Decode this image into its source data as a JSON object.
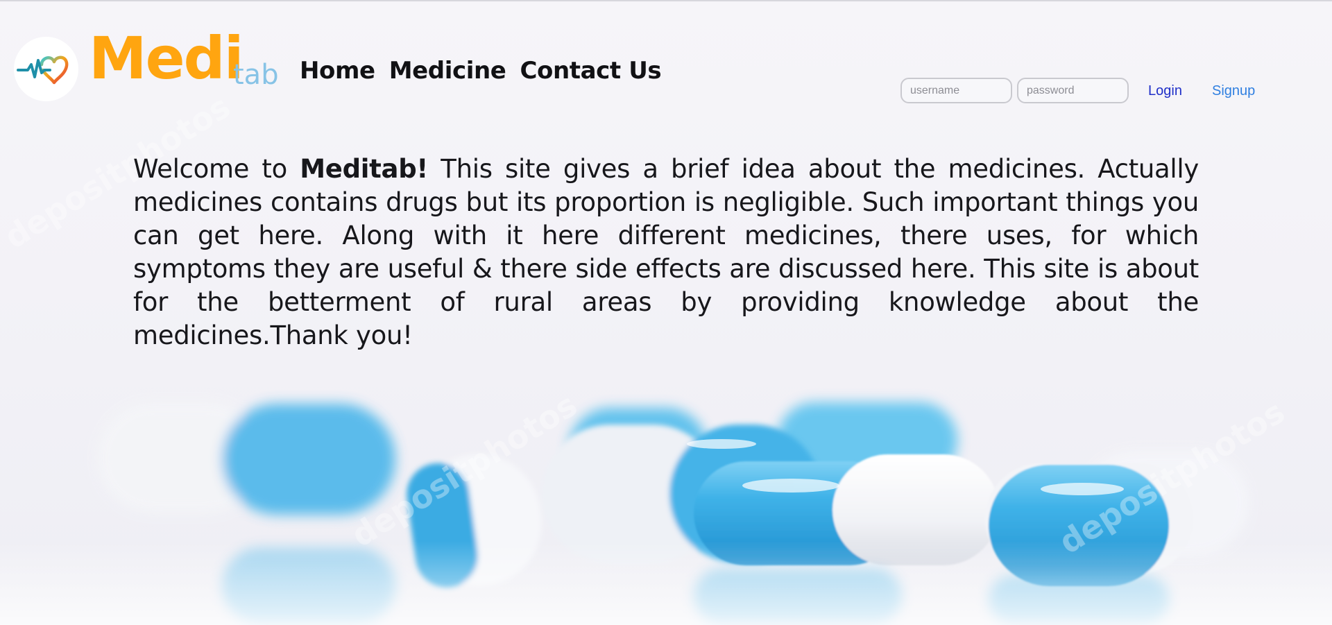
{
  "page": {
    "colors": {
      "brand_orange": "#ffa510",
      "brand_blue": "#87c3e6",
      "pill_blue": "#3fb2e8",
      "login_link": "#1f2fc8",
      "signup_link": "#2f7fe0"
    }
  },
  "header": {
    "logo_icon": "heartbeat-heart-icon",
    "brand_primary": "Medi",
    "brand_secondary": "tab",
    "nav": {
      "home": "Home",
      "medicine": "Medicine",
      "contact": "Contact Us"
    },
    "auth": {
      "username_placeholder": "username",
      "username_value": "",
      "password_placeholder": "password",
      "password_value": "",
      "login_label": "Login",
      "signup_label": "Signup"
    }
  },
  "main": {
    "welcome_prefix": "Welcome to ",
    "welcome_brand": "Meditab!",
    "welcome_body": " This site gives a brief idea about the medicines. Actually medicines contains drugs but its proportion is negligible. Such important things you can get here. Along with it here different medicines, there uses, for which symptoms they are useful & there side effects are discussed here. This site is about for the betterment of rural areas by providing knowledge about the medicines.Thank you!"
  },
  "background": {
    "image": "blue-white-capsules-photo",
    "watermark_text": "depositphotos"
  }
}
